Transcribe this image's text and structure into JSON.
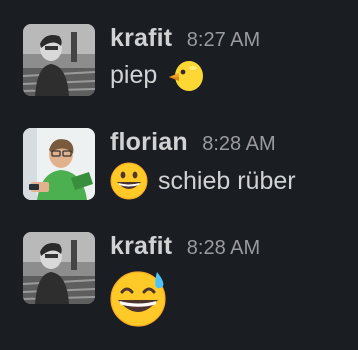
{
  "messages": [
    {
      "author": "krafit",
      "time": "8:27 AM",
      "text": "piep",
      "emoji": "baby-chick-emoji",
      "avatar": "krafit-avatar-photo"
    },
    {
      "author": "florian",
      "time": "8:28 AM",
      "text": "schieb rüber",
      "emoji": "grinning-face-emoji",
      "avatar": "florian-avatar-photo"
    },
    {
      "author": "krafit",
      "time": "8:28 AM",
      "text": "",
      "emoji": "grinning-face-with-sweat-emoji",
      "avatar": "krafit-avatar-photo"
    }
  ],
  "colors": {
    "background": "#1a1d21",
    "text": "#d1d2d3",
    "timestamp": "#9a9b9e"
  }
}
